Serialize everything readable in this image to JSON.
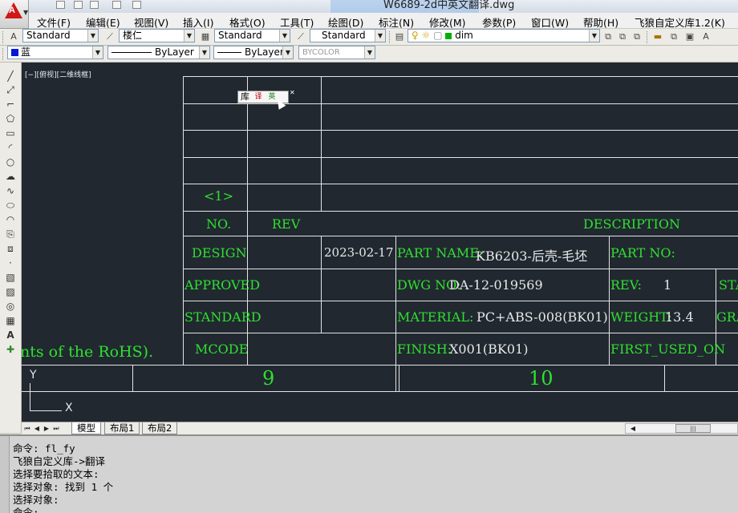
{
  "title": "W6689-2d中英文翻译.dwg",
  "app_logo": "A",
  "menu": [
    "文件(F)",
    "编辑(E)",
    "视图(V)",
    "插入(I)",
    "格式(O)",
    "工具(T)",
    "绘图(D)",
    "标注(N)",
    "修改(M)",
    "参数(P)",
    "窗口(W)",
    "帮助(H)",
    "飞狼自定义库1.2(K)"
  ],
  "toolbar1": {
    "text_style": "Standard",
    "dim_style": "楼仁",
    "table_style": "Standard",
    "multileader_style": "Standard",
    "layer": "dim"
  },
  "toolbar2": {
    "color": "蓝",
    "linetype": "ByLayer",
    "lineweight": "ByLayer",
    "plotstyle": "BYCOLOR"
  },
  "viewport_label": "[−][俯视][二维线框]",
  "popup": {
    "label": "库"
  },
  "drawing": {
    "revision_marker": "<1>",
    "col_headers": {
      "no": "NO.",
      "rev": "REV",
      "description": "DESCRIPTION"
    },
    "rows": {
      "design": "DESIGN",
      "approved": "APPROVED",
      "standard": "STANDARD",
      "mcode": "MCODE"
    },
    "date": "2023-02-17",
    "part_name_label": "PART NAME:",
    "part_name_value": "KB6203-后壳-毛坯",
    "part_no_label": "PART NO:",
    "dwg_no_label": "DWG NO:",
    "dwg_no_value": "DA-12-019569",
    "rev_label": "REV:",
    "rev_value": "1",
    "sta_clip": "STA",
    "material_label": "MATERIAL:",
    "material_value": "PC+ABS-008(BK01)",
    "weight_label": "WEIGHT:",
    "weight_value": "13.4",
    "gra_clip": "GRA",
    "finish_label": "FINISH:",
    "finish_value": "X001(BK01)",
    "first_used_label": "FIRST_USED_ON",
    "rohs_fragment": "nts of the RoHS).",
    "grid_labels": [
      "9",
      "10"
    ],
    "ucs": {
      "y": "Y",
      "x": "X"
    }
  },
  "tabs": [
    "模型",
    "布局1",
    "布局2"
  ],
  "command_lines": [
    "命令: fl_fy",
    "飞狼自定义库->翻译",
    "选择要拾取的文本:",
    "选择对象: 找到 1 个",
    "选择对象:",
    "命令:"
  ]
}
